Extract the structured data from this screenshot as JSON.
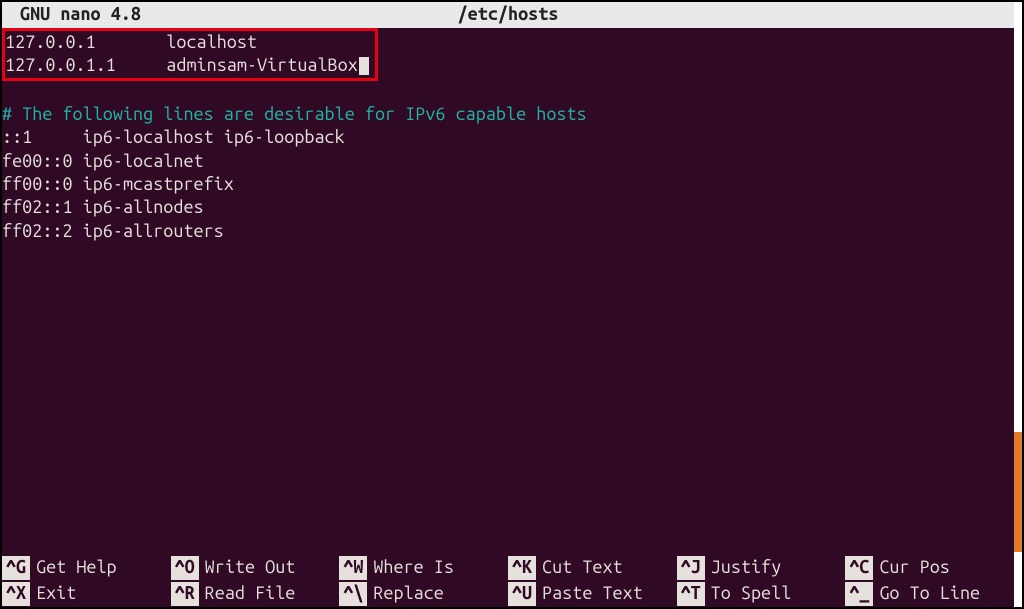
{
  "titlebar": {
    "app": "GNU nano 4.8",
    "file": "/etc/hosts"
  },
  "highlighted_entries": [
    {
      "ip": "127.0.0.1",
      "host": "localhost"
    },
    {
      "ip": "127.0.0.1.1",
      "host": "adminsam-VirtualBox"
    }
  ],
  "comment_line": "# The following lines are desirable for IPv6 capable hosts",
  "ipv6_lines": [
    "::1     ip6-localhost ip6-loopback",
    "fe00::0 ip6-localnet",
    "ff00::0 ip6-mcastprefix",
    "ff02::1 ip6-allnodes",
    "ff02::2 ip6-allrouters"
  ],
  "shortcuts_top": [
    {
      "key": "^G",
      "label": "Get Help"
    },
    {
      "key": "^O",
      "label": "Write Out"
    },
    {
      "key": "^W",
      "label": "Where Is"
    },
    {
      "key": "^K",
      "label": "Cut Text"
    },
    {
      "key": "^J",
      "label": "Justify"
    },
    {
      "key": "^C",
      "label": "Cur Pos"
    }
  ],
  "shortcuts_bottom": [
    {
      "key": "^X",
      "label": "Exit"
    },
    {
      "key": "^R",
      "label": "Read File"
    },
    {
      "key": "^\\",
      "label": "Replace"
    },
    {
      "key": "^U",
      "label": "Paste Text"
    },
    {
      "key": "^T",
      "label": "To Spell"
    },
    {
      "key": "^_",
      "label": "Go To Line"
    }
  ]
}
